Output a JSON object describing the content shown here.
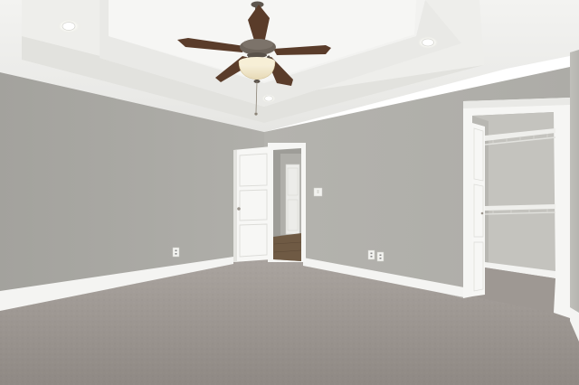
{
  "scene": {
    "subject": "empty-bedroom",
    "colors": {
      "ceiling": "#f1f1ef",
      "tray_face": "#ecebe8",
      "wall_left": "#a9a8a3",
      "wall_back": "#b3b2ad",
      "wall_right": "#bdbcb7",
      "closet_wall": "#c5c4bf",
      "trim": "#f5f5f3",
      "carpet": "#a39d98",
      "carpet_near": "#938d88",
      "fan_blade": "#5a3c2a",
      "fan_metal": "#6b6259",
      "light_glass": "#f3ead0",
      "hall_floor": "#6f5a44"
    }
  }
}
